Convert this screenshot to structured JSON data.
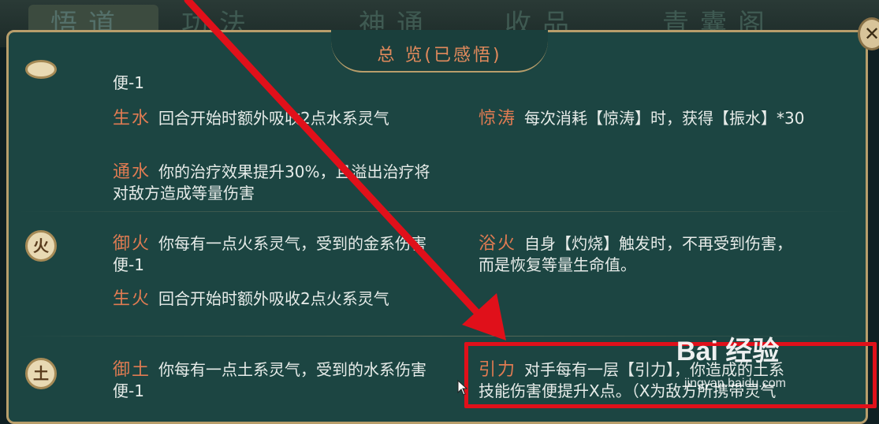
{
  "tabs": [
    "悟道",
    "功法",
    "神通",
    "收品",
    "青囊阁"
  ],
  "panel": {
    "title": "总 览(已感悟)"
  },
  "partial_top": {
    "left_tail": "便-1"
  },
  "water": {
    "icon": "",
    "skills": [
      {
        "name": "生水",
        "desc": "回合开始时额外吸收2点水系灵气"
      },
      {
        "name": "通水",
        "desc": "你的治疗效果提升30%，且溢出治疗将",
        "desc2": "对敌方造成等量伤害"
      },
      {
        "name": "惊涛",
        "desc": "每次消耗【惊涛】时，获得【振水】*30"
      }
    ]
  },
  "fire": {
    "icon": "火",
    "skills": [
      {
        "name": "御火",
        "desc": "你每有一点火系灵气，受到的金系伤害",
        "desc2": "便-1"
      },
      {
        "name": "生火",
        "desc": "回合开始时额外吸收2点火系灵气"
      },
      {
        "name": "浴火",
        "desc": "自身【灼烧】触发时，不再受到伤害，",
        "desc2": "而是恢复等量生命值。"
      }
    ]
  },
  "earth": {
    "icon": "土",
    "skills": [
      {
        "name": "御土",
        "desc": "你每有一点土系灵气，受到的水系伤害",
        "desc2": "便-1"
      },
      {
        "name": "引力",
        "desc": "对手每有一层【引力】，你造成的土系",
        "desc2": "技能伤害便提升X点。（X为敌方所携带灵气"
      }
    ]
  },
  "watermark": {
    "brand": "Bai 经验",
    "url": "jingyan.baidu.com"
  },
  "colors": {
    "panel": "#1c4542",
    "border": "#b89e6b",
    "skill_name": "#e07b52",
    "highlight": "#e0101a",
    "arrow": "#e0101a"
  }
}
